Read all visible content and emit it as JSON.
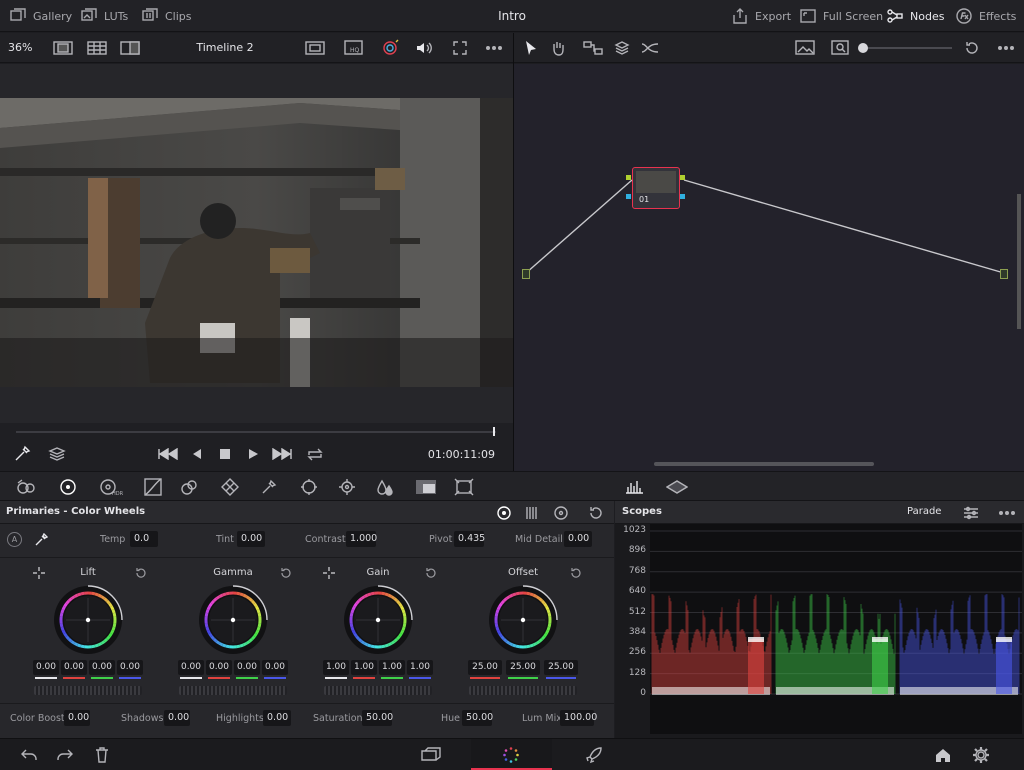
{
  "topbar": {
    "gallery": "Gallery",
    "luts": "LUTs",
    "clips": "Clips",
    "title": "Intro",
    "export": "Export",
    "fullscreen": "Full Screen",
    "nodes": "Nodes",
    "effects": "Effects"
  },
  "viewer_toolbar": {
    "zoom": "36%",
    "timeline": "Timeline 2"
  },
  "transport": {
    "timecode": "01:00:11:09"
  },
  "node": {
    "label": "01"
  },
  "primaries": {
    "title": "Primaries - Color Wheels",
    "auto_label": "A",
    "params_top": [
      {
        "label": "Temp",
        "value": "0.0"
      },
      {
        "label": "Tint",
        "value": "0.00"
      },
      {
        "label": "Contrast",
        "value": "1.000"
      },
      {
        "label": "Pivot",
        "value": "0.435"
      },
      {
        "label": "Mid Detail",
        "value": "0.00"
      }
    ],
    "wheels": [
      {
        "name": "Lift",
        "values": [
          "0.00",
          "0.00",
          "0.00",
          "0.00"
        ]
      },
      {
        "name": "Gamma",
        "values": [
          "0.00",
          "0.00",
          "0.00",
          "0.00"
        ]
      },
      {
        "name": "Gain",
        "values": [
          "1.00",
          "1.00",
          "1.00",
          "1.00"
        ]
      },
      {
        "name": "Offset",
        "values": [
          "25.00",
          "25.00",
          "25.00"
        ]
      }
    ],
    "params_bottom": [
      {
        "label": "Color Boost",
        "value": "0.00"
      },
      {
        "label": "Shadows",
        "value": "0.00"
      },
      {
        "label": "Highlights",
        "value": "0.00"
      },
      {
        "label": "Saturation",
        "value": "50.00"
      },
      {
        "label": "Hue",
        "value": "50.00"
      },
      {
        "label": "Lum Mix",
        "value": "100.00"
      }
    ]
  },
  "scopes": {
    "title": "Scopes",
    "mode": "Parade",
    "scale": [
      "1023",
      "896",
      "768",
      "640",
      "512",
      "384",
      "256",
      "128",
      "0"
    ]
  },
  "colors": {
    "red": "#e0433f",
    "green": "#3fd04a",
    "blue": "#4a57e8",
    "accent_pink": "#e8334f"
  }
}
